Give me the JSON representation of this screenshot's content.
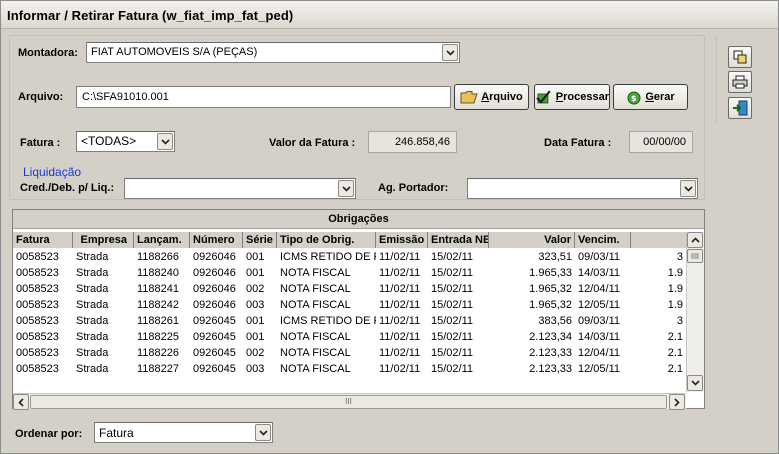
{
  "window": {
    "title": "Informar / Retirar Fatura (w_fiat_imp_fat_ped)"
  },
  "montadora": {
    "label": "Montadora:",
    "value": "FIAT AUTOMOVEIS S/A (PEÇAS)"
  },
  "arquivo": {
    "label": "Arquivo:",
    "value": "C:\\SFA91010.001"
  },
  "buttons": {
    "arquivo_pre": "",
    "arquivo_ul": "A",
    "arquivo_rest": "rquivo",
    "processar_ul": "P",
    "processar_rest": "rocessar",
    "gerar_ul": "G",
    "gerar_rest": "erar"
  },
  "fatura": {
    "label": "Fatura :",
    "value": "<TODAS>"
  },
  "valor_fatura": {
    "label": "Valor da Fatura :",
    "value": "246.858,46"
  },
  "data_fatura": {
    "label": "Data Fatura :",
    "value": "00/00/00"
  },
  "liquidacao": {
    "group_label": "Liquidação",
    "cred_label": "Cred./Deb. p/ Liq.:",
    "cred_value": "",
    "portador_label": "Ag. Portador:",
    "portador_value": ""
  },
  "grid": {
    "title": "Obrigações",
    "columns": [
      "Fatura",
      "Empresa",
      "Lançam.",
      "Número",
      "Série",
      "Tipo de Obrig.",
      "Emissão",
      "Entrada NE",
      "Valor",
      "Vencim.",
      ""
    ],
    "rows": [
      [
        "0058523",
        "Strada",
        "1188266",
        "0926046",
        "001",
        "ICMS RETIDO DE PE",
        "11/02/11",
        "15/02/11",
        "323,51",
        "09/03/11",
        "3"
      ],
      [
        "0058523",
        "Strada",
        "1188240",
        "0926046",
        "001",
        "NOTA FISCAL",
        "11/02/11",
        "15/02/11",
        "1.965,33",
        "14/03/11",
        "1.9"
      ],
      [
        "0058523",
        "Strada",
        "1188241",
        "0926046",
        "002",
        "NOTA FISCAL",
        "11/02/11",
        "15/02/11",
        "1.965,32",
        "12/04/11",
        "1.9"
      ],
      [
        "0058523",
        "Strada",
        "1188242",
        "0926046",
        "003",
        "NOTA FISCAL",
        "11/02/11",
        "15/02/11",
        "1.965,32",
        "12/05/11",
        "1.9"
      ],
      [
        "0058523",
        "Strada",
        "1188261",
        "0926045",
        "001",
        "ICMS RETIDO DE PE",
        "11/02/11",
        "15/02/11",
        "383,56",
        "09/03/11",
        "3"
      ],
      [
        "0058523",
        "Strada",
        "1188225",
        "0926045",
        "001",
        "NOTA FISCAL",
        "11/02/11",
        "15/02/11",
        "2.123,34",
        "14/03/11",
        "2.1"
      ],
      [
        "0058523",
        "Strada",
        "1188226",
        "0926045",
        "002",
        "NOTA FISCAL",
        "11/02/11",
        "15/02/11",
        "2.123,33",
        "12/04/11",
        "2.1"
      ],
      [
        "0058523",
        "Strada",
        "1188227",
        "0926045",
        "003",
        "NOTA FISCAL",
        "11/02/11",
        "15/02/11",
        "2.123,33",
        "12/05/11",
        "2.1"
      ]
    ],
    "hscroll_grip": "III"
  },
  "ordenar": {
    "label": "Ordenar por:",
    "value": "Fatura"
  },
  "icons": {
    "side1": "copy-icon",
    "side2": "print-icon",
    "side3": "exit-door-icon",
    "arquivo": "folder-icon",
    "processar": "check-process-icon",
    "gerar": "generate-icon"
  },
  "colors": {
    "group_label": "#1a3cc8",
    "background": "#d4d0c8"
  }
}
